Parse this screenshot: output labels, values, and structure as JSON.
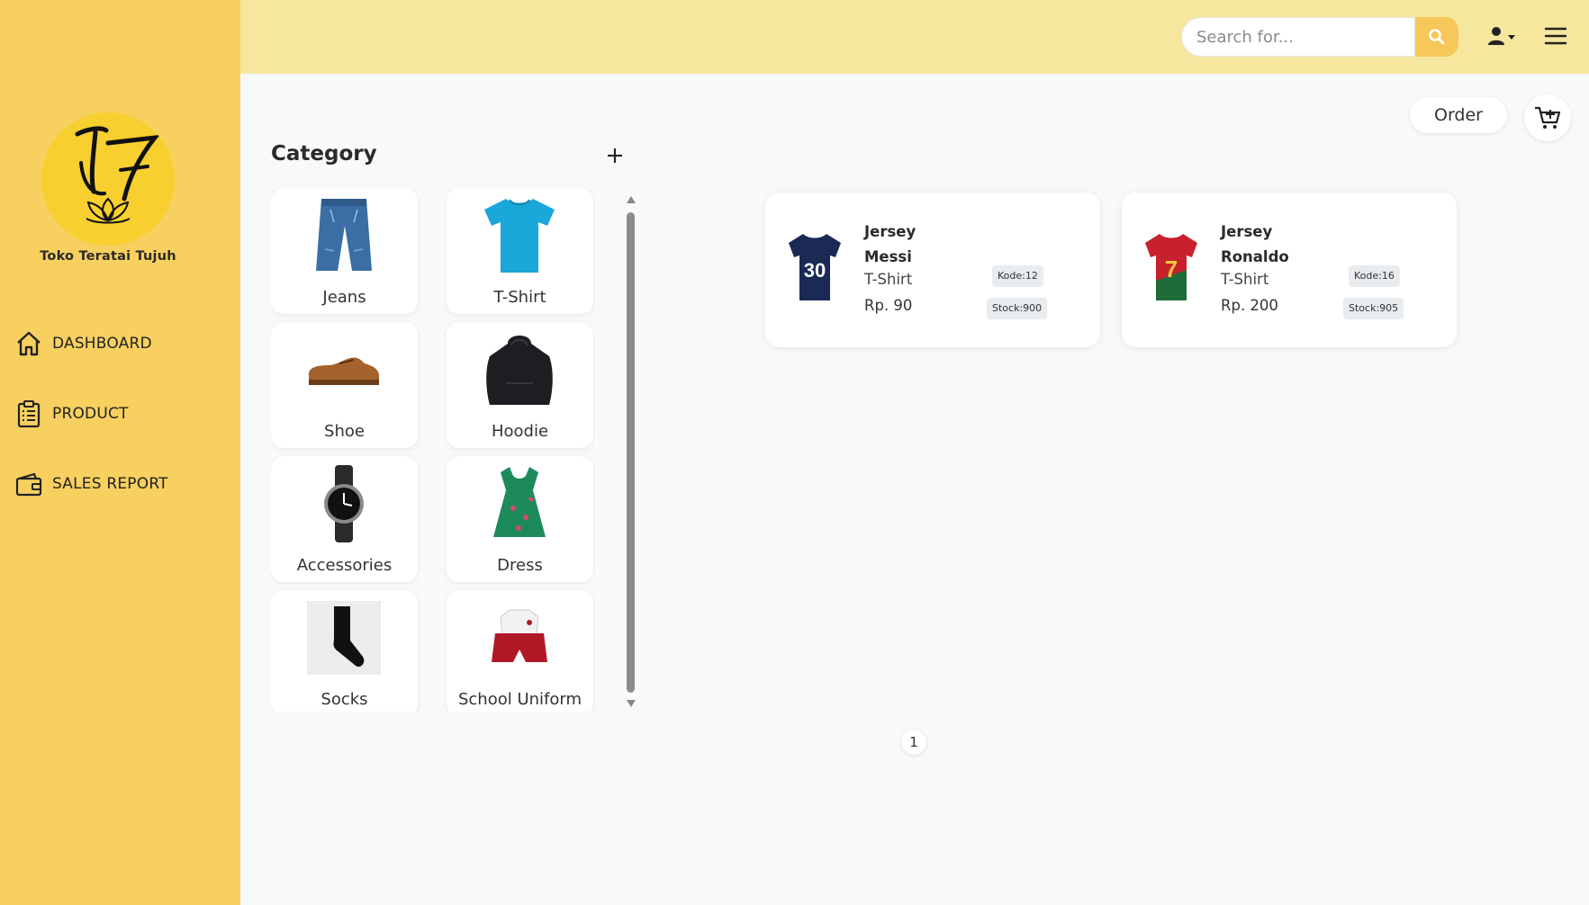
{
  "brand": {
    "name": "Toko Teratai Tujuh"
  },
  "sidebar": {
    "items": [
      {
        "label": "DASHBOARD",
        "icon": "home-icon"
      },
      {
        "label": "PRODUCT",
        "icon": "clipboard-icon"
      },
      {
        "label": "SALES REPORT",
        "icon": "wallet-icon"
      }
    ]
  },
  "header": {
    "search_placeholder": "Search for..."
  },
  "category": {
    "title": "Category",
    "items": [
      {
        "label": "Jeans",
        "icon": "jeans-icon"
      },
      {
        "label": "T-Shirt",
        "icon": "tshirt-icon"
      },
      {
        "label": "Shoe",
        "icon": "shoe-icon"
      },
      {
        "label": "Hoodie",
        "icon": "hoodie-icon"
      },
      {
        "label": "Accessories",
        "icon": "watch-icon"
      },
      {
        "label": "Dress",
        "icon": "dress-icon"
      },
      {
        "label": "Socks",
        "icon": "socks-icon"
      },
      {
        "label": "School Uniform",
        "icon": "school-uniform-icon"
      }
    ]
  },
  "actions": {
    "order_label": "Order"
  },
  "products": [
    {
      "name": "Jersey Messi",
      "category": "T-Shirt",
      "price": "Rp. 90",
      "kode": "Kode:12",
      "stock": "Stock:900",
      "jersey_color": "#1b2a55",
      "number": "30"
    },
    {
      "name": "Jersey Ronaldo",
      "category": "T-Shirt",
      "price": "Rp. 200",
      "kode": "Kode:16",
      "stock": "Stock:905",
      "jersey_color": "#c8202c",
      "number": "7"
    }
  ],
  "pagination": {
    "current": "1"
  },
  "colors": {
    "sidebar": "#f8d060",
    "topbar": "#f5e79e",
    "accent": "#f6c85a"
  }
}
